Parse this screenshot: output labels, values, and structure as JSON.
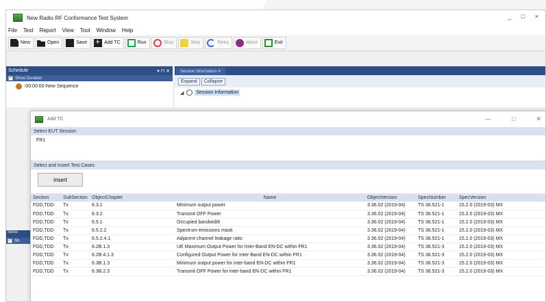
{
  "window": {
    "title": "New Radio RF Conformance Test System",
    "controls": "_ □ ×"
  },
  "menu": [
    "File",
    "Test",
    "Report",
    "View",
    "Tool",
    "Window",
    "Help"
  ],
  "toolbar": {
    "new": "New",
    "open": "Open",
    "save": "Save",
    "add_tc": "Add TC",
    "run": "Run",
    "stop": "Stop",
    "step": "Step",
    "retry": "Retry",
    "abort": "Abort",
    "exit": "Exit"
  },
  "schedule": {
    "title": "Schedule",
    "controls": "▾ ⊓ ✕",
    "show_duration": "Show Duration",
    "item": "-00:00:00-New Sequence"
  },
  "session": {
    "tab": "Session Information ✕",
    "expand": "Expand",
    "collapse": "Collapse",
    "node": "Session Information"
  },
  "lower_left": {
    "h1": "Sessi",
    "h2": "Sh"
  },
  "dialog": {
    "title": "Add TC",
    "min": "—",
    "max": "□",
    "close": "✕",
    "eut_header": "Select EUT Session",
    "eut_value": "FR1",
    "tc_header": "Select and Insert Test Cases",
    "insert": "Insert"
  },
  "table": {
    "headers": [
      "Section",
      "SubSection",
      "ObjectChapter",
      "Name",
      "ObjectVersion",
      "SpecNumber",
      "SpecVersion"
    ],
    "rows": [
      [
        "FDD,TDD",
        "Tx",
        "6.3.1",
        "Minimum output power",
        "3.36.02 (2019-04)",
        "TS 38.521-1",
        "15.2.0 (2019-03) MX"
      ],
      [
        "FDD,TDD",
        "Tx",
        "6.3.2",
        "Transmit OFF Power",
        "3.36.02 (2019-04)",
        "TS 38.521-1",
        "15.2.0 (2019-03) MX"
      ],
      [
        "FDD,TDD",
        "Tx",
        "6.5.1",
        "Occupied bandwidth",
        "3.36.02 (2019-04)",
        "TS 38.521-1",
        "15.2.0 (2019-03) MX"
      ],
      [
        "FDD,TDD",
        "Tx",
        "6.5.2.2",
        "Spectrum emissions mask",
        "3.36.02 (2019-04)",
        "TS 38.521-1",
        "15.2.0 (2019-03) MX"
      ],
      [
        "FDD,TDD",
        "Tx",
        "6.5.2.4.1",
        "Adjacent channel leakage ratio",
        "3.36.02 (2019-04)",
        "TS 38.521-1",
        "15.2.0 (2019-03) MX"
      ],
      [
        "FDD,TDD",
        "Tx",
        "6.2B.1.3",
        "UE Maximum Output Power for Inter-Band EN-DC within FR1",
        "3.36.02 (2019-04)",
        "TS 38.521-3",
        "15.2.0 (2019-03) MX"
      ],
      [
        "FDD,TDD",
        "Tx",
        "6.2B.4.1.3",
        "Configured Output Power for Inter-Band EN-DC within FR1",
        "3.36.02 (2019-04)",
        "TS 38.521-3",
        "15.2.0 (2019-03) MX"
      ],
      [
        "FDD,TDD",
        "Tx",
        "6.3B.1.3",
        "Minimum output power for inter-band EN-DC within FR1",
        "3.36.02 (2019-04)",
        "TS 38.521-3",
        "15.2.0 (2019-03) MX"
      ],
      [
        "FDD,TDD",
        "Tx",
        "6.3B.2.3",
        "Transmit OFF Power for inter-band EN-DC within FR1",
        "3.36.02 (2019-04)",
        "TS 38.521-3",
        "15.2.0 (2019-03) MX"
      ]
    ]
  }
}
